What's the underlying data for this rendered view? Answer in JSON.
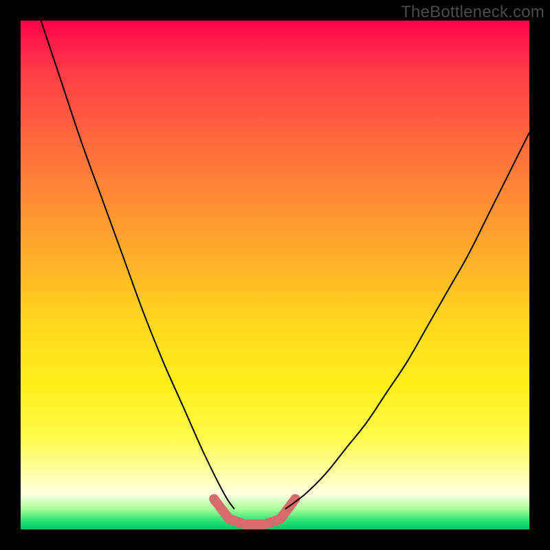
{
  "watermark": "TheBottleneck.com",
  "colors": {
    "frame": "#000000",
    "gradient_top": "#ff004a",
    "gradient_mid": "#ffd91c",
    "gradient_bottom": "#00c46a",
    "curve": "#000000",
    "indicator": "#d86b6b"
  },
  "chart_data": {
    "type": "line",
    "title": "",
    "xlabel": "",
    "ylabel": "",
    "x_range": [
      0,
      100
    ],
    "y_range": [
      0,
      100
    ],
    "grid": false,
    "legend": false,
    "series": [
      {
        "name": "left-branch",
        "x": [
          4,
          8,
          12,
          16,
          20,
          24,
          28,
          32,
          36,
          40,
          42
        ],
        "y": [
          100,
          88,
          76,
          65,
          54,
          43,
          33,
          24,
          15,
          7,
          4
        ]
      },
      {
        "name": "right-branch",
        "x": [
          52,
          56,
          60,
          64,
          68,
          72,
          76,
          80,
          84,
          88,
          92,
          96,
          100
        ],
        "y": [
          4,
          7,
          11,
          16,
          21,
          27,
          33,
          40,
          47,
          54,
          62,
          70,
          78
        ]
      },
      {
        "name": "valley-indicator",
        "x": [
          38,
          41,
          44,
          48,
          51,
          54
        ],
        "y": [
          6,
          2,
          1,
          1,
          2,
          6
        ]
      }
    ],
    "annotations": [
      {
        "text": "TheBottleneck.com",
        "position": "top-right"
      }
    ]
  }
}
